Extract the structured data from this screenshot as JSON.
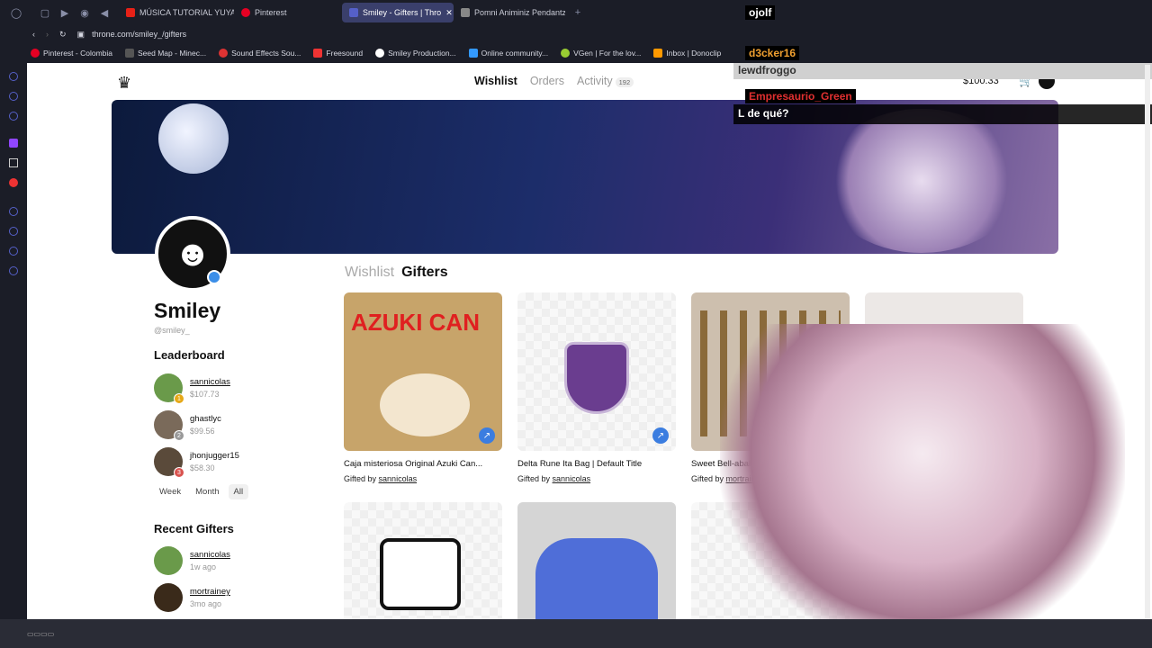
{
  "browser": {
    "tabs": [
      {
        "label": "MÚSICA TUTORIAL YUYA",
        "color": "#e62117"
      },
      {
        "label": "Pinterest",
        "color": "#e60023"
      },
      {
        "label": "Smiley - Gifters | Thro",
        "color": "#5560c8",
        "active": true
      },
      {
        "label": "Pomni Animiniz Pendantz",
        "color": "#888888"
      }
    ],
    "url": "throne.com/smiley_/gifters",
    "bookmarks": [
      {
        "label": "Pinterest - Colombia",
        "color": "#e60023"
      },
      {
        "label": "Seed Map - Minec...",
        "color": "#555"
      },
      {
        "label": "Sound Effects Sou...",
        "color": "#d33"
      },
      {
        "label": "Freesound",
        "color": "#e33"
      },
      {
        "label": "Smiley Production...",
        "color": "#fff"
      },
      {
        "label": "Online community...",
        "color": "#39f"
      },
      {
        "label": "VGen | For the lov...",
        "color": "#9c3"
      },
      {
        "label": "Inbox | Donoclip",
        "color": "#f90"
      }
    ]
  },
  "nav": {
    "wishlist": "Wishlist",
    "orders": "Orders",
    "activity": "Activity",
    "activity_count": "192",
    "balance": "$100.33"
  },
  "profile": {
    "name": "Smiley",
    "handle": "@smiley_"
  },
  "leaderboard": {
    "title": "Leaderboard",
    "entries": [
      {
        "name": "sannicolas",
        "amount": "$107.73",
        "rank": "1",
        "color": "#6a9a4a",
        "rank_color": "#e6a817"
      },
      {
        "name": "ghastlyc",
        "amount": "$99.56",
        "rank": "2",
        "color": "#7a6a5a",
        "rank_color": "#999999"
      },
      {
        "name": "jhonjugger15",
        "amount": "$58.30",
        "rank": "3",
        "color": "#5a4a3a",
        "rank_color": "#d9534f"
      }
    ],
    "periods": [
      "Week",
      "Month",
      "All"
    ]
  },
  "recent": {
    "title": "Recent Gifters",
    "entries": [
      {
        "name": "sannicolas",
        "time": "1w ago",
        "color": "#6a9a4a"
      },
      {
        "name": "mortrainey",
        "time": "3mo ago",
        "color": "#3a2a1a"
      }
    ]
  },
  "gift_tabs": {
    "wishlist": "Wishlist",
    "gifters": "Gifters"
  },
  "gifted_by_label": "Gifted by",
  "cards": [
    {
      "title": "Caja misteriosa Original Azuki Can...",
      "gifter": "sannicolas",
      "img": "AZUKI CAN"
    },
    {
      "title": "Delta Rune Ita Bag | Default Title",
      "gifter": "sannicolas",
      "img": ""
    },
    {
      "title": "Sweet Bell-abalori",
      "gifter": "mortraine",
      "img": ""
    }
  ],
  "chat": [
    {
      "name": "ojolf",
      "color": "#ffffff",
      "bg": "#000000"
    },
    {
      "name": "d3cker16",
      "color": "#f0a030",
      "bg": "#000000"
    },
    {
      "name": "lewdfroggo",
      "color": "#333333",
      "bg": "#d0d0d0"
    },
    {
      "name": "Empresaurio_Green",
      "color": "#e03030",
      "bg": "#000000"
    },
    {
      "message": "L de qué?"
    }
  ]
}
